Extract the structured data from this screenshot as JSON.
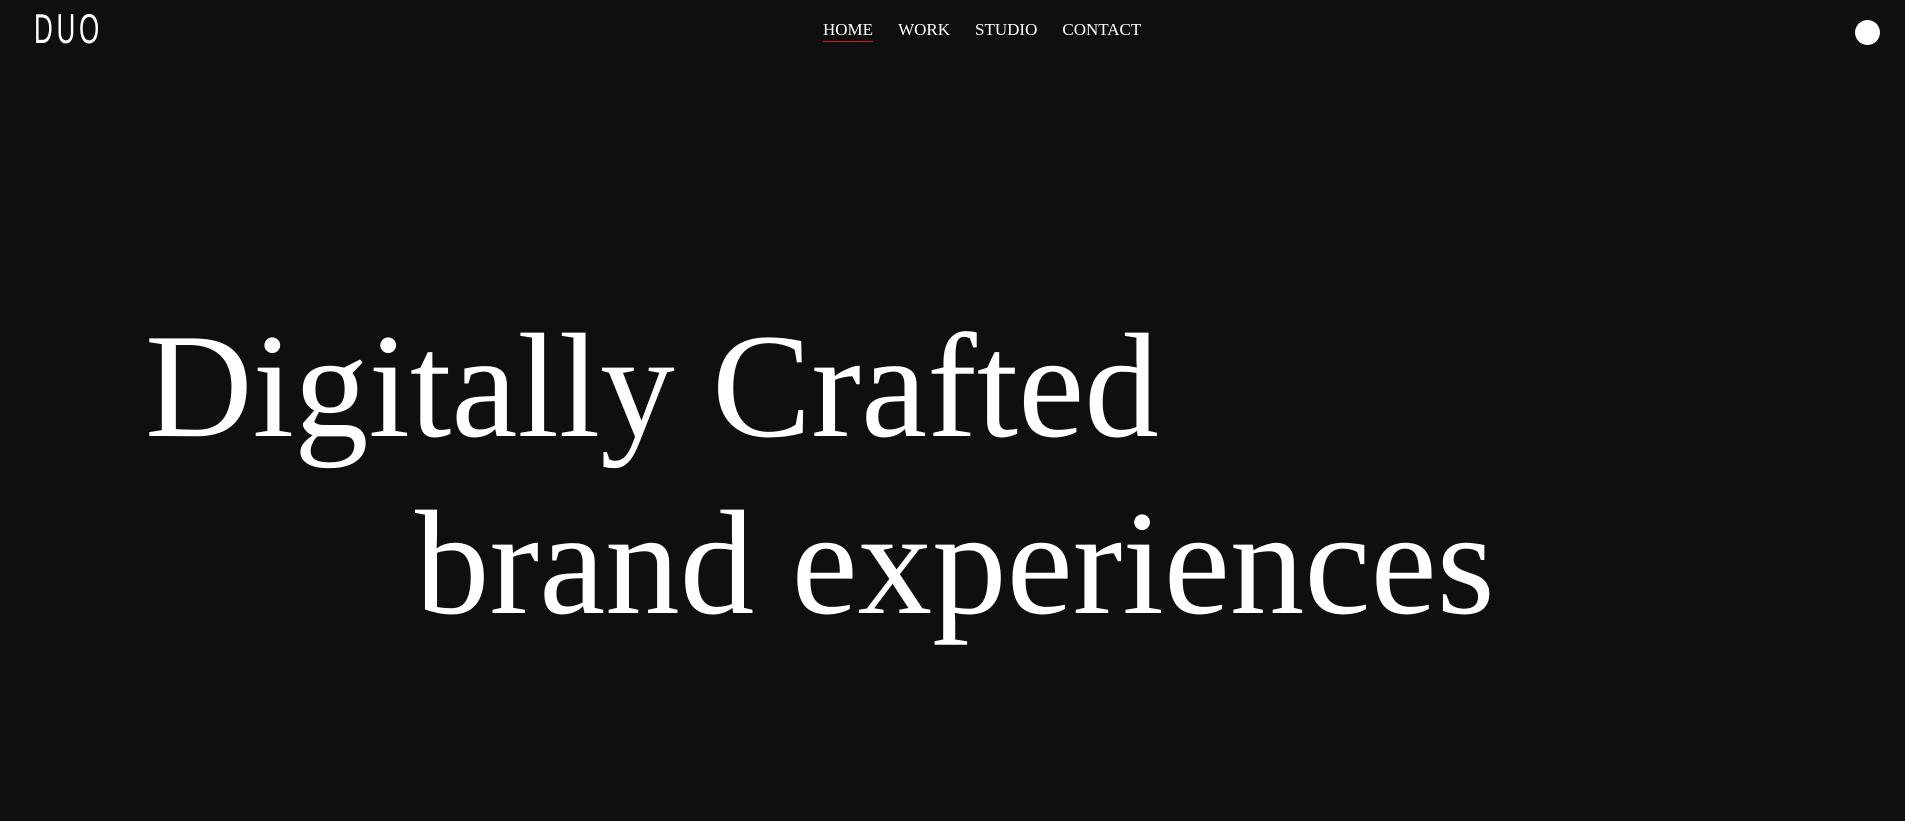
{
  "header": {
    "logo_text": "DUO",
    "nav": {
      "items": [
        {
          "label": "HOME",
          "active": true
        },
        {
          "label": "WORK",
          "active": false
        },
        {
          "label": "STUDIO",
          "active": false
        },
        {
          "label": "CONTACT",
          "active": false
        }
      ]
    },
    "menu_button_icon": "circle-dot-icon"
  },
  "hero": {
    "line1": "Digitally Crafted",
    "line2": "brand experiences"
  },
  "colors": {
    "background": "#100f10",
    "text": "#ffffff",
    "active_underline": "#d11a1a"
  }
}
